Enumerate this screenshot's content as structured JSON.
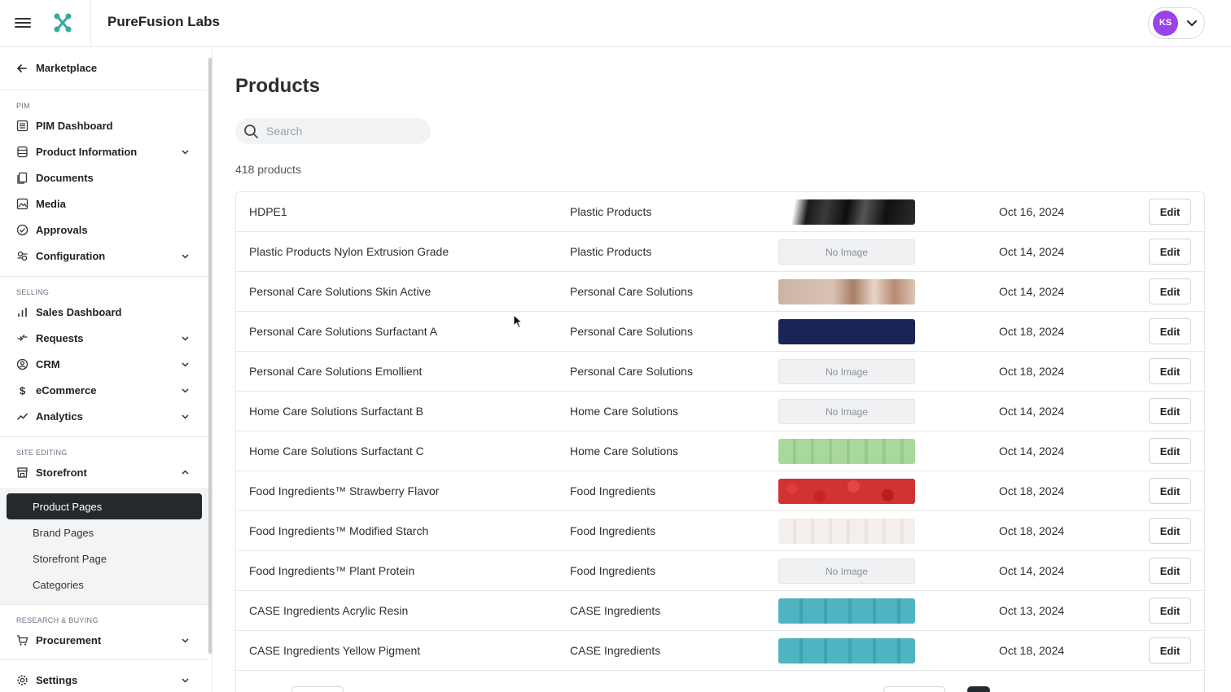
{
  "header": {
    "brand": "PureFusion Labs",
    "user_initials": "KS",
    "avatar_color": "#9b42e8"
  },
  "sidebar": {
    "back_label": "Marketplace",
    "sections": [
      {
        "heading": "PIM"
      },
      {
        "heading": "SELLING"
      },
      {
        "heading": "SITE EDITING"
      },
      {
        "heading": "RESEARCH & BUYING"
      }
    ],
    "items": [
      {
        "label": "PIM Dashboard",
        "icon": "list-icon"
      },
      {
        "label": "Product Information",
        "icon": "database-icon"
      },
      {
        "label": "Documents",
        "icon": "documents-icon"
      },
      {
        "label": "Media",
        "icon": "media-icon"
      },
      {
        "label": "Approvals",
        "icon": "check-circle-icon"
      },
      {
        "label": "Configuration",
        "icon": "config-icon"
      },
      {
        "label": "Sales Dashboard",
        "icon": "bar-chart-icon"
      },
      {
        "label": "Requests",
        "icon": "requests-icon"
      },
      {
        "label": "CRM",
        "icon": "user-circle-icon"
      },
      {
        "label": "eCommerce",
        "icon": "dollar-icon"
      },
      {
        "label": "Analytics",
        "icon": "trend-icon"
      },
      {
        "label": "Storefront",
        "icon": "storefront-icon"
      },
      {
        "label": "Procurement",
        "icon": "cart-icon"
      },
      {
        "label": "Settings",
        "icon": "gear-icon"
      }
    ],
    "storefront_sub": [
      {
        "label": "Product Pages",
        "active": true
      },
      {
        "label": "Brand Pages"
      },
      {
        "label": "Storefront Page"
      },
      {
        "label": "Categories"
      }
    ]
  },
  "main": {
    "title": "Products",
    "search_placeholder": "Search",
    "count_text": "418 products",
    "no_image_label": "No Image",
    "edit_label": "Edit",
    "products": [
      {
        "name": "HDPE1",
        "category": "Plastic Products",
        "image": "black-pipe",
        "date": "Oct 16, 2024"
      },
      {
        "name": "Plastic Products Nylon Extrusion Grade",
        "category": "Plastic Products",
        "image": "none",
        "date": "Oct 14, 2024"
      },
      {
        "name": "Personal Care Solutions Skin Active",
        "category": "Personal Care Solutions",
        "image": "face",
        "date": "Oct 14, 2024"
      },
      {
        "name": "Personal Care Solutions Surfactant A",
        "category": "Personal Care Solutions",
        "image": "navy",
        "date": "Oct 18, 2024"
      },
      {
        "name": "Personal Care Solutions Emollient",
        "category": "Personal Care Solutions",
        "image": "none",
        "date": "Oct 18, 2024"
      },
      {
        "name": "Home Care Solutions Surfactant B",
        "category": "Home Care Solutions",
        "image": "none",
        "date": "Oct 14, 2024"
      },
      {
        "name": "Home Care Solutions Surfactant C",
        "category": "Home Care Solutions",
        "image": "green-pattern",
        "date": "Oct 14, 2024"
      },
      {
        "name": "Food Ingredients™ Strawberry Flavor",
        "category": "Food Ingredients",
        "image": "strawberries",
        "date": "Oct 18, 2024"
      },
      {
        "name": "Food Ingredients™ Modified Starch",
        "category": "Food Ingredients",
        "image": "light-pattern",
        "date": "Oct 18, 2024"
      },
      {
        "name": "Food Ingredients™ Plant Protein",
        "category": "Food Ingredients",
        "image": "none",
        "date": "Oct 14, 2024"
      },
      {
        "name": "CASE Ingredients Acrylic Resin",
        "category": "CASE Ingredients",
        "image": "teal-pattern",
        "date": "Oct 13, 2024"
      },
      {
        "name": "CASE Ingredients Yellow Pigment",
        "category": "CASE Ingredients",
        "image": "teal-pattern",
        "date": "Oct 18, 2024"
      }
    ]
  }
}
